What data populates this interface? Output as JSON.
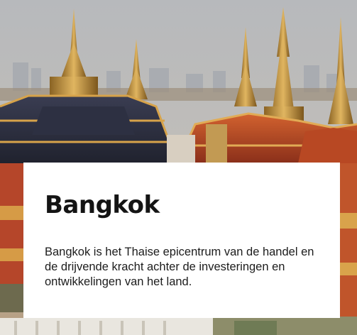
{
  "destination": {
    "title": "Bangkok",
    "description": "Bangkok is het Thaise epicentrum van de handel en de drijvende kracht achter de investeringen en ontwikkelingen van het land."
  },
  "colors": {
    "sky": "#9aa3ad",
    "roof_orange": "#c8552a",
    "gold": "#c99a3a",
    "card_background": "#ffffff",
    "text": "#141414"
  }
}
